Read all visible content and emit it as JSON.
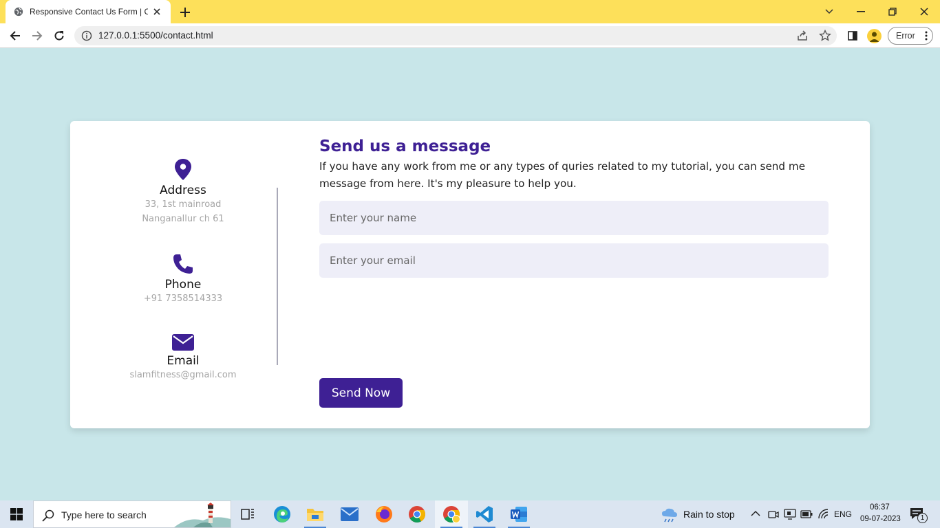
{
  "browser": {
    "tab_title": "Responsive Contact Us Form | Co",
    "url": "127.0.0.1:5500/contact.html",
    "profile_status": "Error"
  },
  "contact_info": {
    "address": {
      "label": "Address",
      "line1": "33, 1st mainroad",
      "line2": "Nanganallur ch 61",
      "icon": "map-pin-icon"
    },
    "phone": {
      "label": "Phone",
      "value": "+91 7358514333",
      "icon": "phone-icon"
    },
    "email": {
      "label": "Email",
      "value": "slamfitness@gmail.com",
      "icon": "envelope-icon"
    }
  },
  "form": {
    "title": "Send us a message",
    "description": "If you have any work from me or any types of quries related to my tutorial, you can send me message from here. It's my pleasure to help you.",
    "name_placeholder": "Enter your name",
    "email_placeholder": "Enter your email",
    "submit_label": "Send Now"
  },
  "taskbar": {
    "search_placeholder": "Type here to search",
    "weather": "Rain to stop",
    "language": "ENG",
    "time": "06:37",
    "date": "09-07-2023",
    "notification_count": "1"
  },
  "colors": {
    "accent": "#3e2094",
    "page_background": "#c8e6e9",
    "input_background": "#eeeef8",
    "chrome_tabbar": "#fde05a"
  }
}
